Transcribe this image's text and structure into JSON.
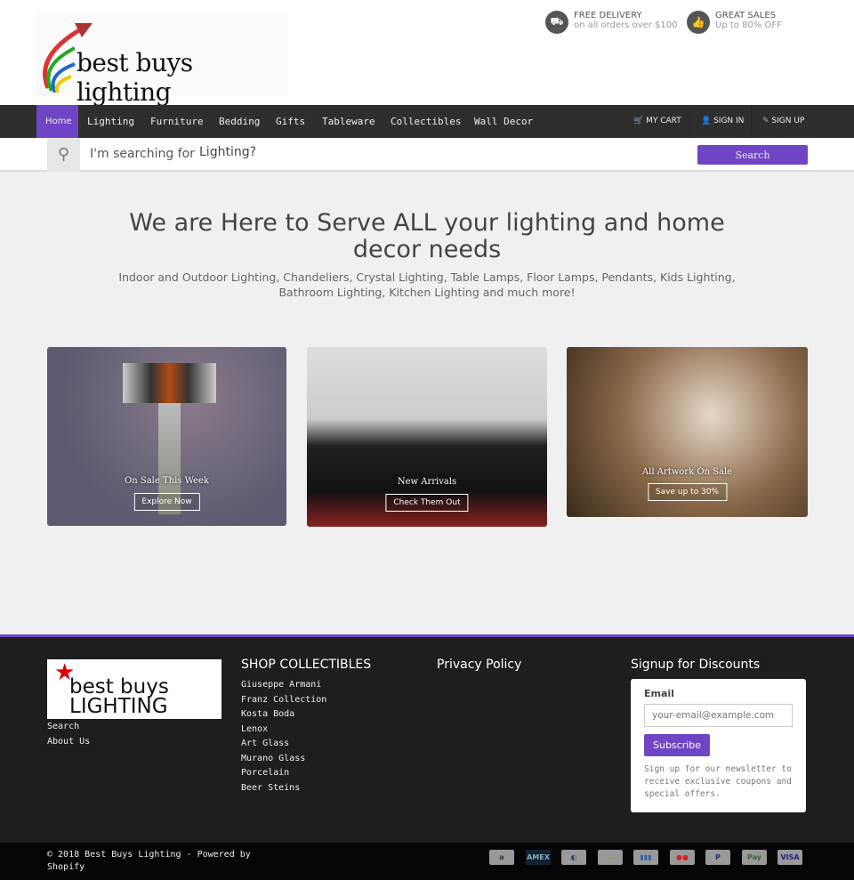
{
  "header": {
    "logo_text": "best buys lighting",
    "promos": [
      {
        "icon": "truck-icon",
        "title": "FREE DELIVERY",
        "sub": "on all orders over $100"
      },
      {
        "icon": "thumbs-up-icon",
        "title": "GREAT SALES",
        "sub": "Up to 80% OFF"
      }
    ]
  },
  "nav": {
    "items": [
      "Home",
      "Lighting",
      "Furniture",
      "Bedding",
      "Gifts",
      "Tableware",
      "Collectibles",
      "Wall Decor"
    ],
    "active": "Home",
    "account": [
      {
        "icon": "cart-icon",
        "label": "MY CART"
      },
      {
        "icon": "user-icon",
        "label": "SIGN IN"
      },
      {
        "icon": "edit-icon",
        "label": "SIGN UP"
      }
    ]
  },
  "search": {
    "label": "I'm searching for",
    "value": "Lighting?",
    "button": "Search"
  },
  "hero": {
    "title": "We are Here to Serve ALL your lighting and home decor needs",
    "subtitle": "Indoor and Outdoor Lighting, Chandeliers, Crystal Lighting, Table Lamps, Floor Lamps, Pendants, Kids Lighting, Bathroom Lighting, Kitchen Lighting and much more!"
  },
  "cards": [
    {
      "title": "On Sale This Week",
      "button": "Explore Now"
    },
    {
      "title": "New Arrivals",
      "button": "Check Them Out"
    },
    {
      "title": "All Artwork On Sale",
      "button": "Save up to 30%"
    }
  ],
  "footer": {
    "logo_text": "best buys LIGHTING",
    "links": [
      "Search",
      "About Us"
    ],
    "collectibles_title": "SHOP COLLECTIBLES",
    "collectibles": [
      "Giuseppe Armani",
      "Franz Collection",
      "Kosta Boda",
      "Lenox",
      "Art Glass",
      "Murano Glass",
      "Porcelain",
      "Beer Steins"
    ],
    "policy_title": "Privacy Policy",
    "signup_title": "Signup for Discounts",
    "email_label": "Email",
    "email_placeholder": "your-email@example.com",
    "subscribe": "Subscribe",
    "signup_note": "Sign up for our newsletter to receive exclusive coupons and special offers."
  },
  "bottom": {
    "copyright": "© 2018 Best Buys Lighting - Powered by Shopify",
    "payments": [
      "Amazon",
      "AMEX",
      "Diners",
      "Discover",
      "JCB",
      "Mastercard",
      "PayPal",
      "Apple Pay",
      "VISA"
    ]
  },
  "colors": {
    "accent": "#6f45c5",
    "nav": "#2e2e2e",
    "footer": "#1e1e1e"
  }
}
